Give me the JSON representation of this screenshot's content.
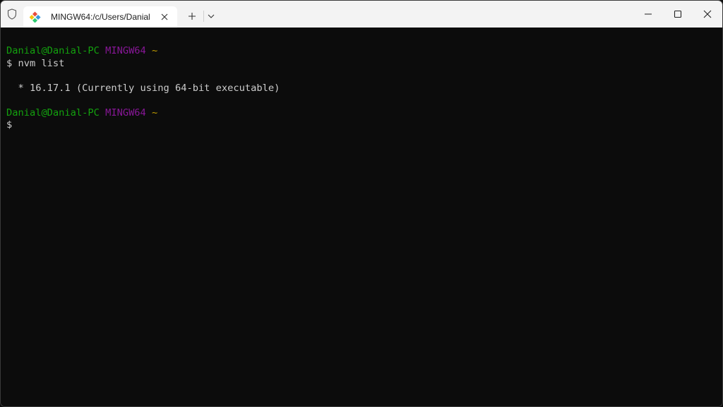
{
  "tab": {
    "title": "MINGW64:/c/Users/Danial",
    "icon": "git-diamond-icon",
    "close_icon": "close-icon"
  },
  "titlebar": {
    "shield_icon": "shield-icon",
    "new_tab_icon": "plus-icon",
    "dropdown_icon": "chevron-down-icon",
    "controls": [
      "minimize-icon",
      "maximize-icon",
      "close-icon"
    ]
  },
  "terminal": {
    "prompt1": {
      "user_host": "Danial@Danial-PC",
      "env": "MINGW64",
      "dir": "~"
    },
    "cmd1": "$ nvm list",
    "output1": "  * 16.17.1 (Currently using 64-bit executable)",
    "prompt2": {
      "user_host": "Danial@Danial-PC",
      "env": "MINGW64",
      "dir": "~"
    },
    "cmd2": "$"
  },
  "colors": {
    "background": "#0c0c0c",
    "user_host": "#13a10e",
    "env": "#881798",
    "dir": "#c19c00",
    "text": "#cccccc"
  }
}
